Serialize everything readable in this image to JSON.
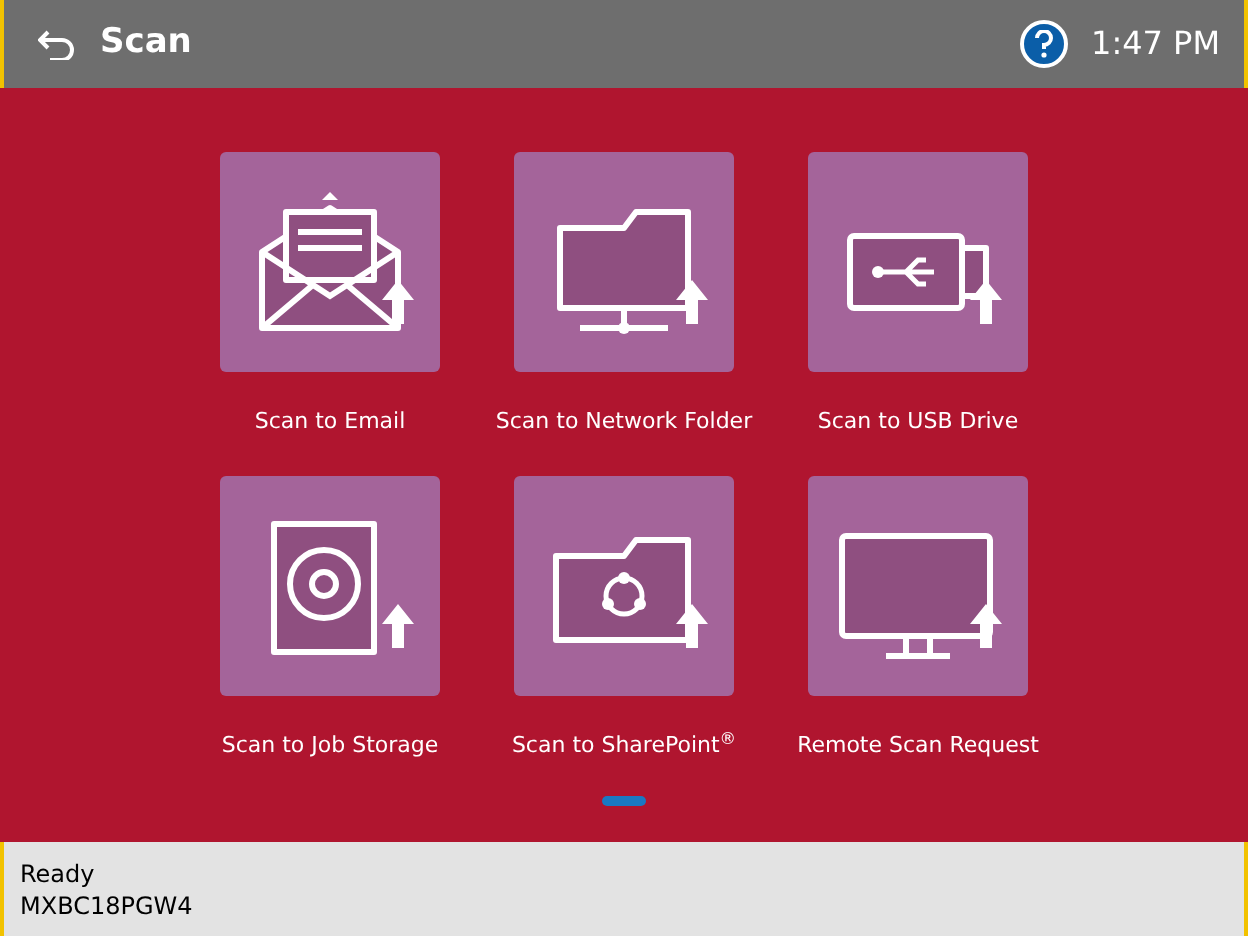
{
  "header": {
    "title": "Scan",
    "time": "1:47 PM"
  },
  "tiles": [
    {
      "kind": "email",
      "label": "Scan to Email"
    },
    {
      "kind": "folder",
      "label": "Scan to Network Folder"
    },
    {
      "kind": "usb",
      "label": "Scan to USB Drive"
    },
    {
      "kind": "storage",
      "label": "Scan to Job Storage"
    },
    {
      "kind": "sharepoint",
      "label": "Scan to SharePoint$^{®}$"
    },
    {
      "kind": "remote",
      "label": "Remote Scan Request"
    }
  ],
  "pager": [
    {
      "selected": true
    }
  ],
  "status_bar": {
    "status": "Ready",
    "device": "MXBC18PGW4"
  }
}
